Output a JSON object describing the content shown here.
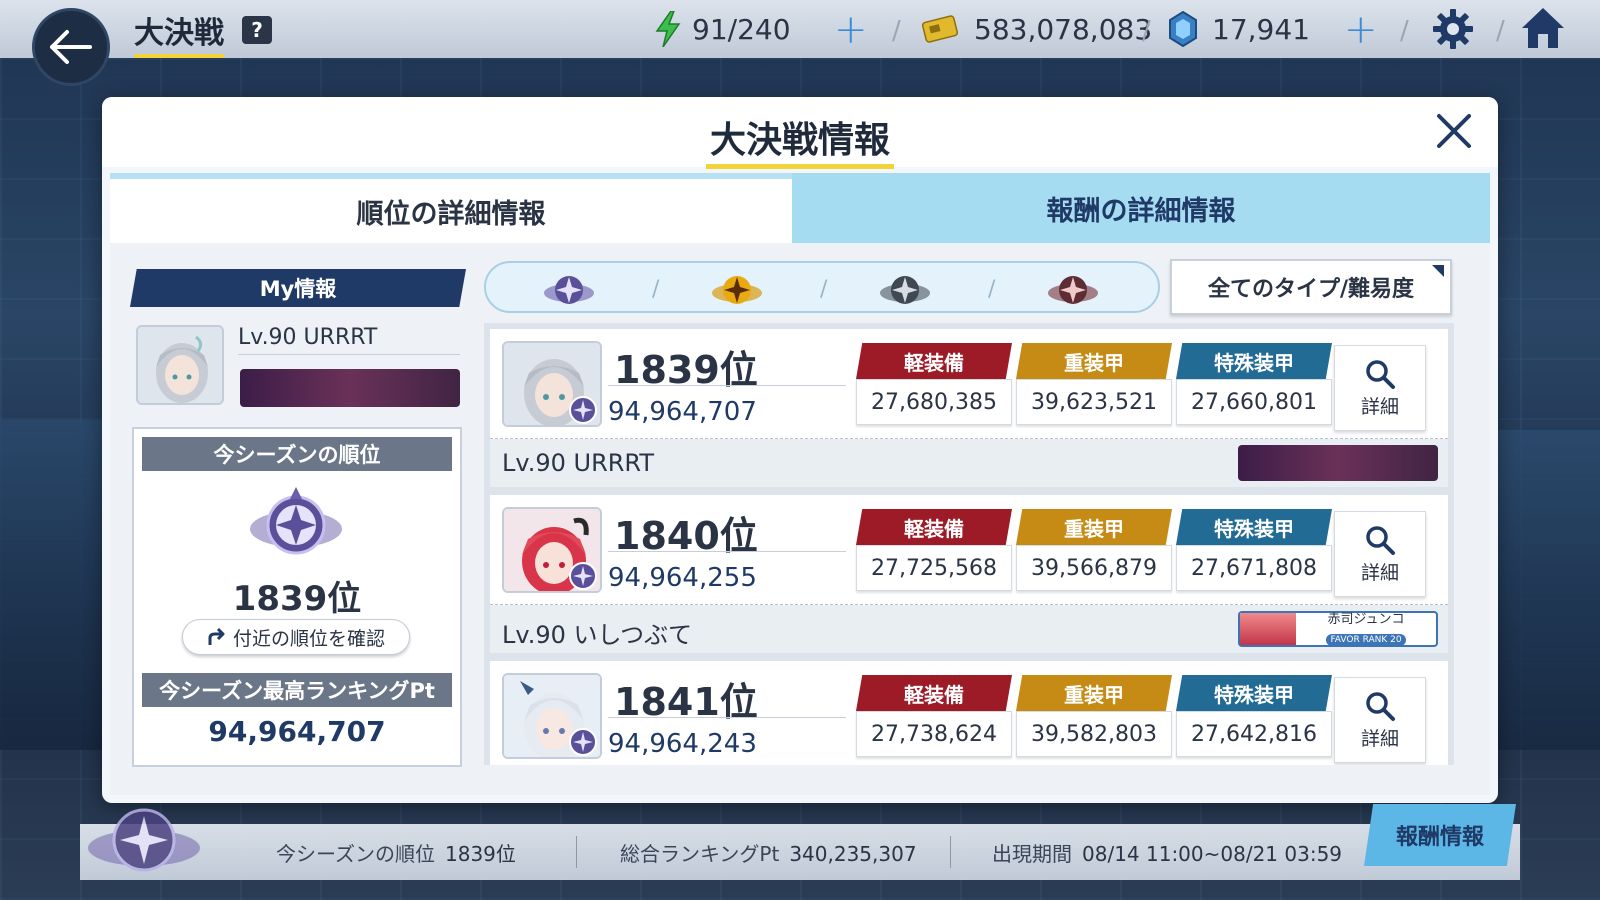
{
  "topbar": {
    "title": "大決戦",
    "help": "?",
    "ap": "91/240",
    "credits": "583,078,083",
    "gems": "17,941"
  },
  "modal": {
    "title": "大決戦情報",
    "tabs": [
      {
        "label": "順位の詳細情報",
        "active": true
      },
      {
        "label": "報酬の詳細情報",
        "active": false
      }
    ]
  },
  "my_info": {
    "header": "My情報",
    "name": "Lv.90 URRRT",
    "season_rank_label": "今シーズンの順位",
    "season_rank": "1839位",
    "nearby_button": "付近の順位を確認",
    "best_pt_label": "今シーズン最高ランキングPt",
    "best_pt": "94,964,707"
  },
  "filter": {
    "type_select": "全てのタイプ/難易度"
  },
  "score_labels": {
    "light": "軽装備",
    "heavy": "重装甲",
    "special": "特殊装甲",
    "detail": "詳細"
  },
  "rankings": [
    {
      "rank": "1839位",
      "pt": "94,964,707",
      "light": "27,680,385",
      "heavy": "39,623,521",
      "special": "27,660,801",
      "name": "Lv.90 URRRT",
      "footer": "banner"
    },
    {
      "rank": "1840位",
      "pt": "94,964,255",
      "light": "27,725,568",
      "heavy": "39,566,879",
      "special": "27,671,808",
      "name": "Lv.90 いしつぶて",
      "footer": "card",
      "card_name": "赤司ジュンコ",
      "card_rank": "FAVOR RANK 20"
    },
    {
      "rank": "1841位",
      "pt": "94,964,243",
      "light": "27,738,624",
      "heavy": "39,582,803",
      "special": "27,642,816",
      "name": "",
      "footer": "none"
    }
  ],
  "bottombar": {
    "season_rank_label": "今シーズンの順位",
    "season_rank": "1839位",
    "total_pt_label": "総合ランキングPt",
    "total_pt": "340,235,307",
    "period_label": "出現期間",
    "period": "08/14 11:00~08/21 03:59",
    "reward_button": "報酬情報"
  },
  "colors": {
    "light": "#9c1b26",
    "heavy": "#c58b14",
    "special": "#226b94",
    "accent": "#f2d43a",
    "navy": "#1f3a66"
  }
}
